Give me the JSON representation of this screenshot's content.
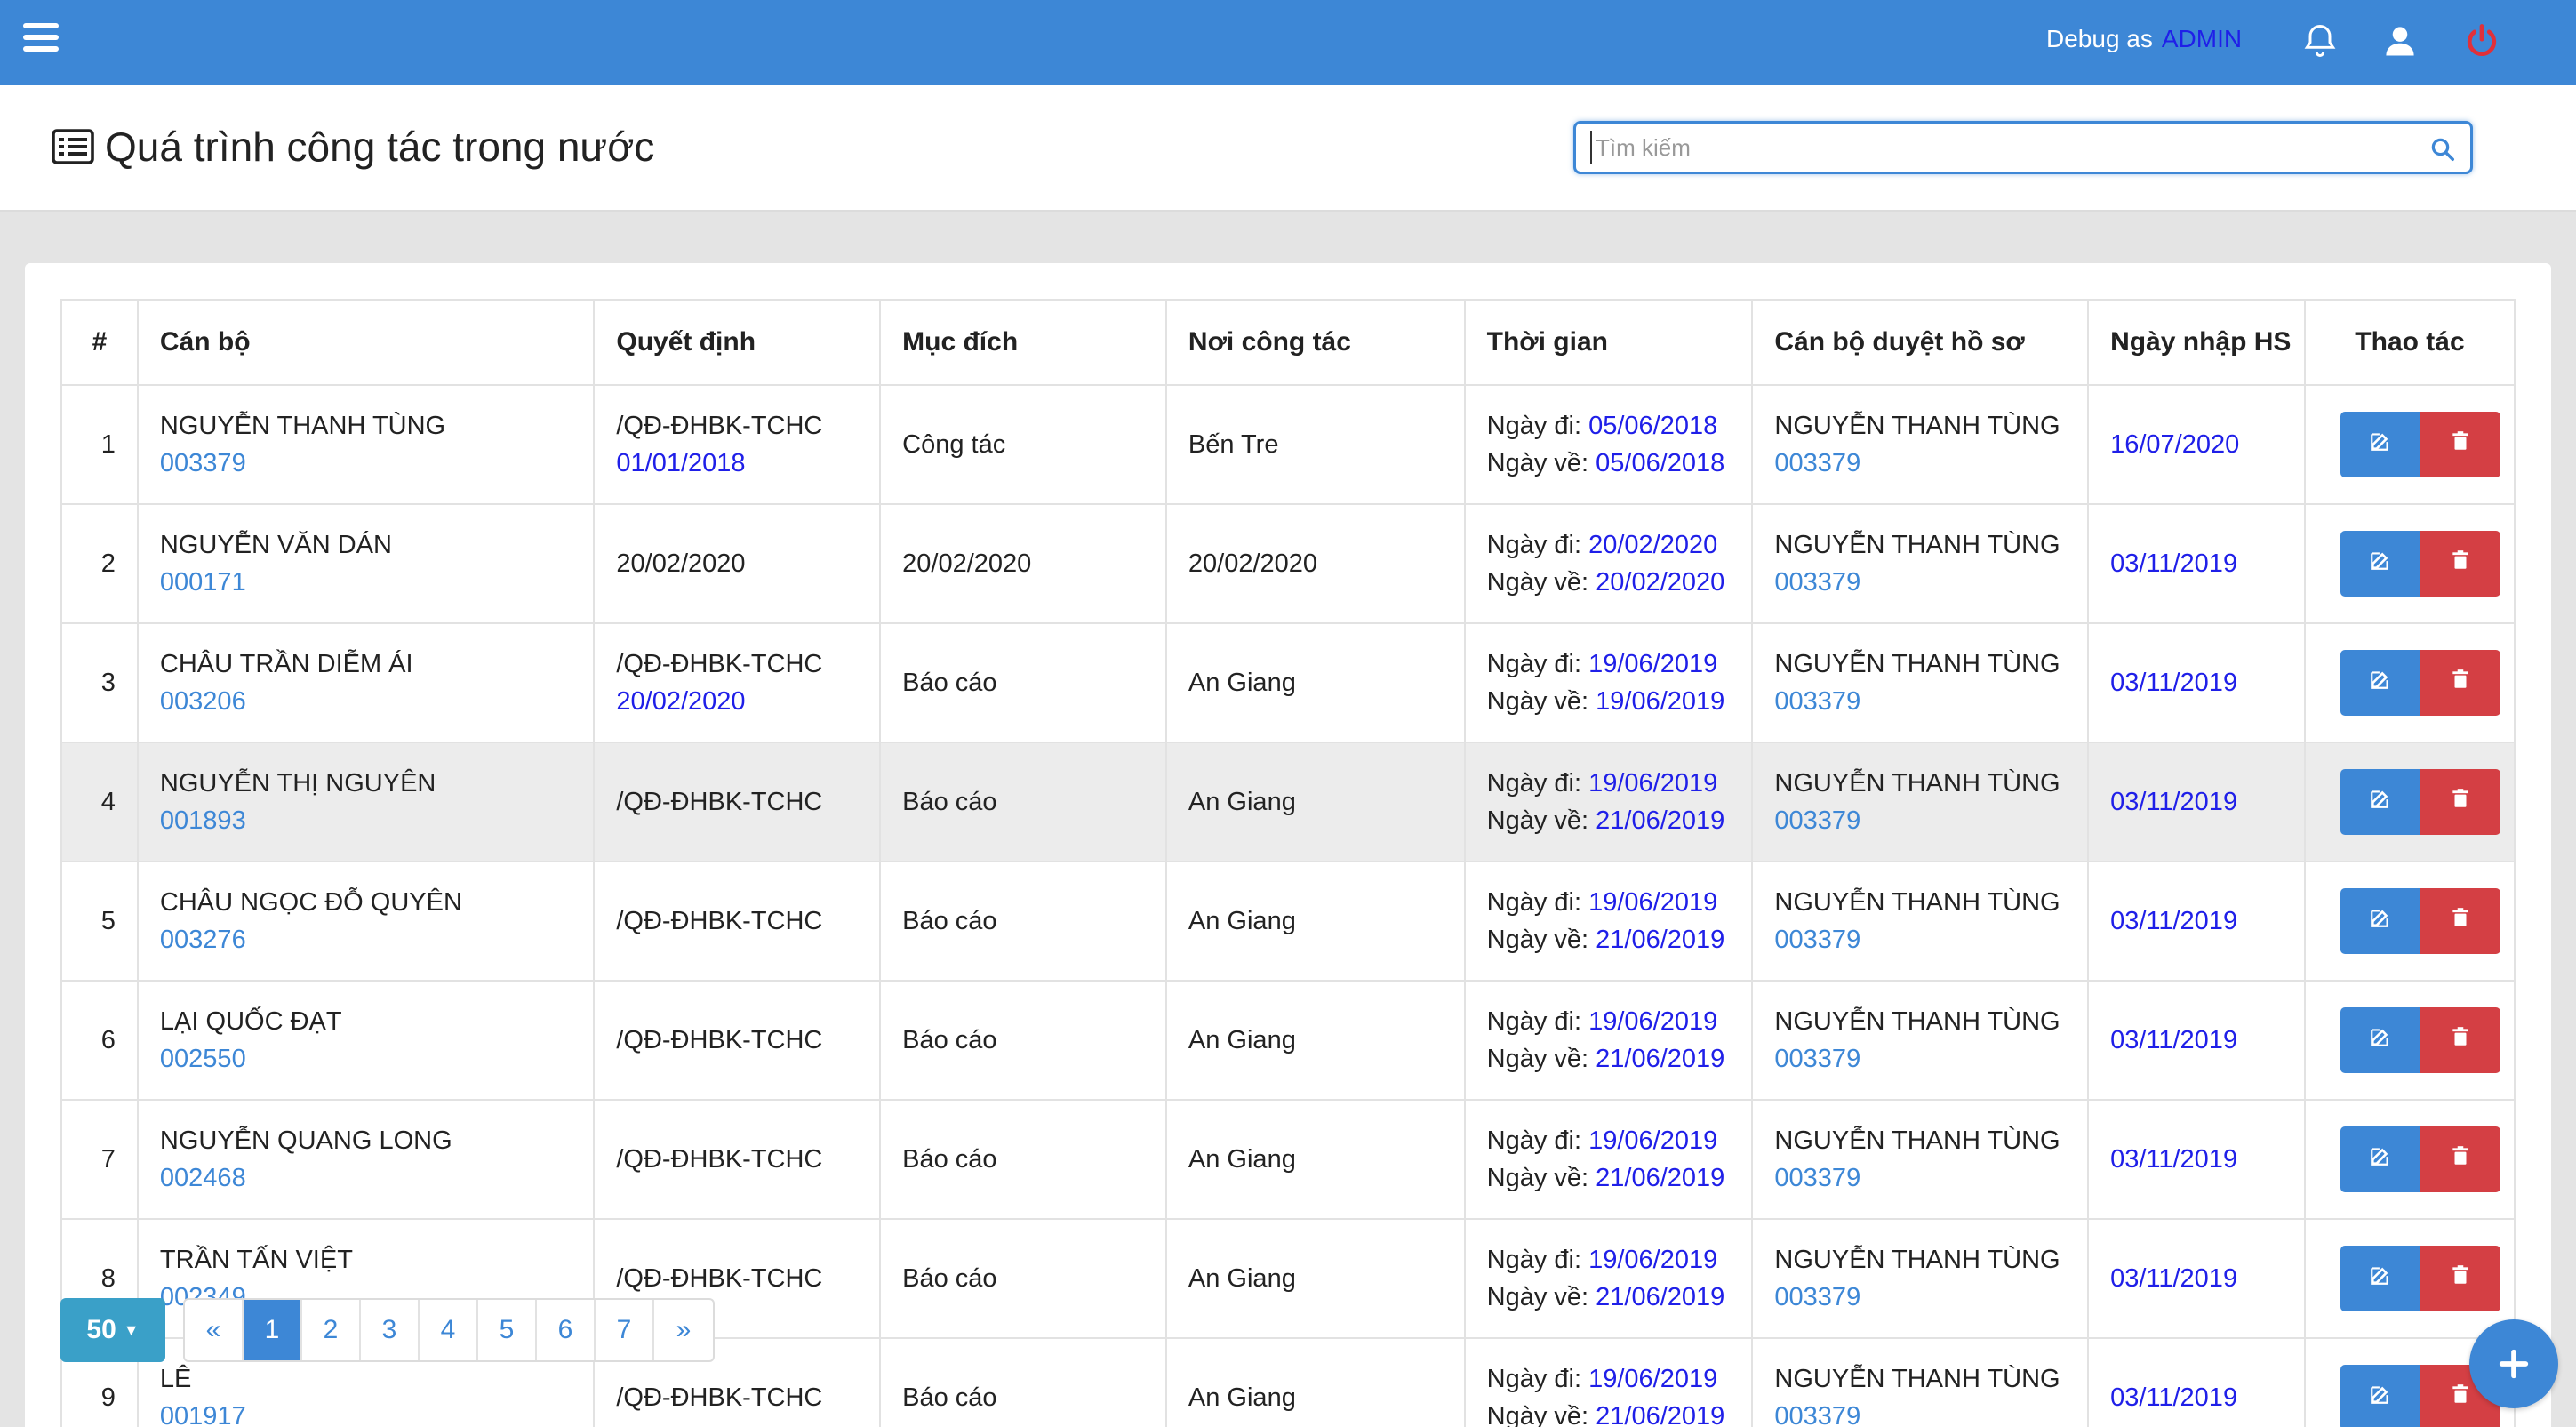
{
  "topbar": {
    "debug_label": "Debug as",
    "debug_user": "ADMIN"
  },
  "header": {
    "title": "Quá trình công tác trong nước",
    "search_placeholder": "Tìm kiếm"
  },
  "table": {
    "columns": [
      "#",
      "Cán bộ",
      "Quyết định",
      "Mục đích",
      "Nơi công tác",
      "Thời gian",
      "Cán bộ duyệt hồ sơ",
      "Ngày nhập HS",
      "Thao tác"
    ],
    "date_go_label": "Ngày đi:",
    "date_return_label": "Ngày về:",
    "rows": [
      {
        "no": "1",
        "name": "NGUYỄN THANH TÙNG",
        "code": "003379",
        "decision": "/QĐ-ĐHBK-TCHC",
        "decision_date": "01/01/2018",
        "purpose": "Công tác",
        "place": "Bến Tre",
        "date_go": "05/06/2018",
        "date_return": "05/06/2018",
        "approver": "NGUYỄN THANH TÙNG",
        "approver_code": "003379",
        "entry_date": "16/07/2020"
      },
      {
        "no": "2",
        "name": "NGUYỄN VĂN DÁN",
        "code": "000171",
        "decision": "20/02/2020",
        "decision_date": "",
        "purpose": "20/02/2020",
        "place": "20/02/2020",
        "date_go": "20/02/2020",
        "date_return": "20/02/2020",
        "approver": "NGUYỄN THANH TÙNG",
        "approver_code": "003379",
        "entry_date": "03/11/2019"
      },
      {
        "no": "3",
        "name": "CHÂU TRẦN DIỄM ÁI",
        "code": "003206",
        "decision": "/QĐ-ĐHBK-TCHC",
        "decision_date": "20/02/2020",
        "purpose": "Báo cáo",
        "place": "An Giang",
        "date_go": "19/06/2019",
        "date_return": "19/06/2019",
        "approver": "NGUYỄN THANH TÙNG",
        "approver_code": "003379",
        "entry_date": "03/11/2019"
      },
      {
        "no": "4",
        "name": "NGUYỄN THỊ NGUYÊN",
        "code": "001893",
        "decision": "/QĐ-ĐHBK-TCHC",
        "decision_date": "",
        "purpose": "Báo cáo",
        "place": "An Giang",
        "date_go": "19/06/2019",
        "date_return": "21/06/2019",
        "approver": "NGUYỄN THANH TÙNG",
        "approver_code": "003379",
        "entry_date": "03/11/2019"
      },
      {
        "no": "5",
        "name": "CHÂU NGỌC ĐỖ QUYÊN",
        "code": "003276",
        "decision": "/QĐ-ĐHBK-TCHC",
        "decision_date": "",
        "purpose": "Báo cáo",
        "place": "An Giang",
        "date_go": "19/06/2019",
        "date_return": "21/06/2019",
        "approver": "NGUYỄN THANH TÙNG",
        "approver_code": "003379",
        "entry_date": "03/11/2019"
      },
      {
        "no": "6",
        "name": "LẠI QUỐC ĐẠT",
        "code": "002550",
        "decision": "/QĐ-ĐHBK-TCHC",
        "decision_date": "",
        "purpose": "Báo cáo",
        "place": "An Giang",
        "date_go": "19/06/2019",
        "date_return": "21/06/2019",
        "approver": "NGUYỄN THANH TÙNG",
        "approver_code": "003379",
        "entry_date": "03/11/2019"
      },
      {
        "no": "7",
        "name": "NGUYỄN QUANG LONG",
        "code": "002468",
        "decision": "/QĐ-ĐHBK-TCHC",
        "decision_date": "",
        "purpose": "Báo cáo",
        "place": "An Giang",
        "date_go": "19/06/2019",
        "date_return": "21/06/2019",
        "approver": "NGUYỄN THANH TÙNG",
        "approver_code": "003379",
        "entry_date": "03/11/2019"
      },
      {
        "no": "8",
        "name": "TRẦN TẤN VIỆT",
        "code": "002349",
        "decision": "/QĐ-ĐHBK-TCHC",
        "decision_date": "",
        "purpose": "Báo cáo",
        "place": "An Giang",
        "date_go": "19/06/2019",
        "date_return": "21/06/2019",
        "approver": "NGUYỄN THANH TÙNG",
        "approver_code": "003379",
        "entry_date": "03/11/2019"
      },
      {
        "no": "9",
        "name": "LÊ",
        "code": "001917",
        "decision": "/QĐ-ĐHBK-TCHC",
        "decision_date": "",
        "purpose": "Báo cáo",
        "place": "An Giang",
        "date_go": "19/06/2019",
        "date_return": "21/06/2019",
        "approver": "NGUYỄN THANH TÙNG",
        "approver_code": "003379",
        "entry_date": "03/11/2019"
      }
    ]
  },
  "pagination": {
    "page_size": "50",
    "pages": [
      "«",
      "1",
      "2",
      "3",
      "4",
      "5",
      "6",
      "7",
      "»"
    ],
    "active": "1"
  }
}
